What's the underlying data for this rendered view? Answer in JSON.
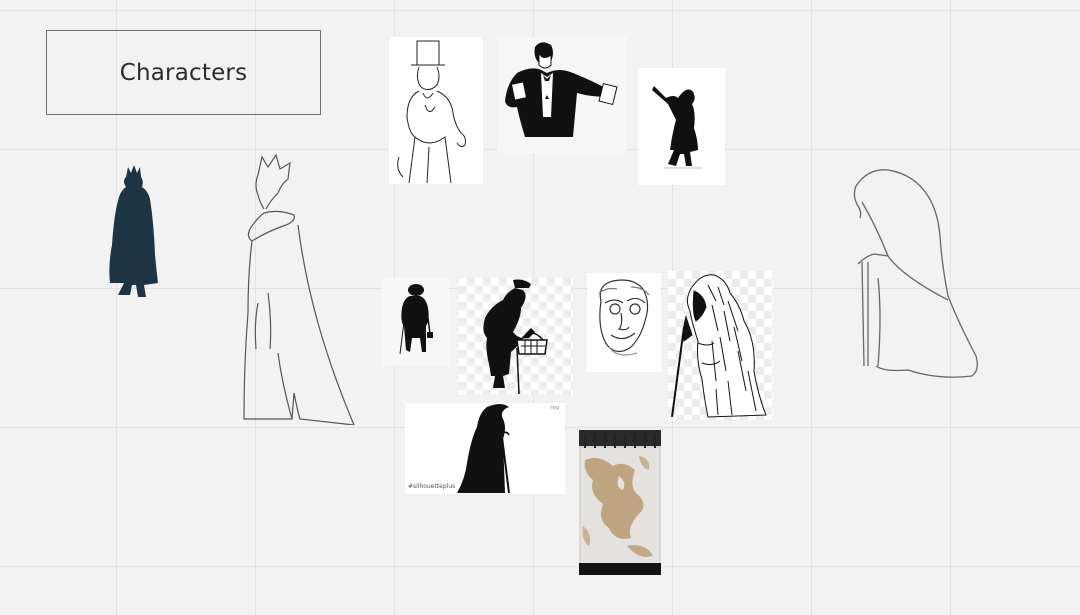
{
  "board": {
    "frame_title": "Characters"
  },
  "cards": {
    "silhouette_watermark": "#silhouetteplus",
    "silhouette_corner": "svg"
  },
  "colors": {
    "canvas": "#f2f2f2",
    "grid": "#e2e2e2",
    "frame_border": "#707070",
    "queen_fill": "#1c3443",
    "ink": "#111111",
    "sketch_stroke": "#555555"
  },
  "icons": {
    "queen_silhouette": "queen-silhouette-icon",
    "queen_sketch": "queen-outline-sketch-icon",
    "hooded_sketch": "hooded-figure-sketch-icon"
  }
}
